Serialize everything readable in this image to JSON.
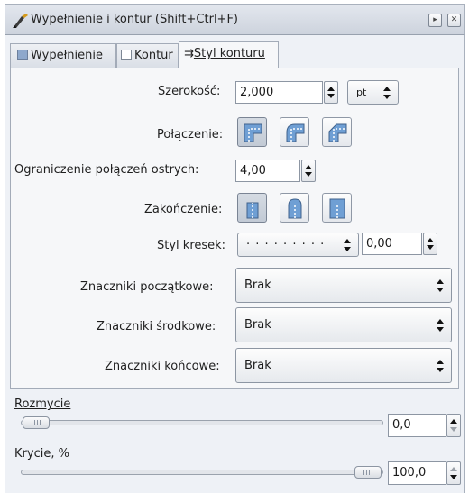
{
  "window": {
    "title": "Wypełnienie i kontur (Shift+Ctrl+F)",
    "pin_glyph": "▸",
    "close_glyph": "✕"
  },
  "tabs": [
    {
      "label": "Wypełnienie"
    },
    {
      "label": "Kontur"
    },
    {
      "label": "Styl konturu",
      "glyph": "⇉",
      "active": true
    }
  ],
  "stroke_style": {
    "width": {
      "label": "Szerokość:",
      "value": "2,000",
      "unit": "pt"
    },
    "join": {
      "label": "Połączenie:",
      "options": [
        "miter-join",
        "round-join",
        "bevel-join"
      ],
      "selected": 0
    },
    "miter_limit": {
      "label": "Ograniczenie połączeń ostrych:",
      "value": "4,00"
    },
    "cap": {
      "label": "Zakończenie:",
      "options": [
        "butt-cap",
        "round-cap",
        "square-cap"
      ],
      "selected": 0
    },
    "dashes": {
      "label": "Styl kresek:",
      "pattern": "· · · · · · · · ·",
      "offset": "0,00"
    },
    "start_markers": {
      "label": "Znaczniki początkowe:",
      "value": "Brak"
    },
    "mid_markers": {
      "label": "Znaczniki środkowe:",
      "value": "Brak"
    },
    "end_markers": {
      "label": "Znaczniki końcowe:",
      "value": "Brak"
    }
  },
  "blur": {
    "label": "Rozmycie",
    "value": "0,0",
    "level": 0.0
  },
  "opacity": {
    "label": "Krycie, %",
    "value": "100,0",
    "level": 1.0
  },
  "colors": {
    "accent": "#8ea8cc",
    "panel": "#eef1f6"
  }
}
